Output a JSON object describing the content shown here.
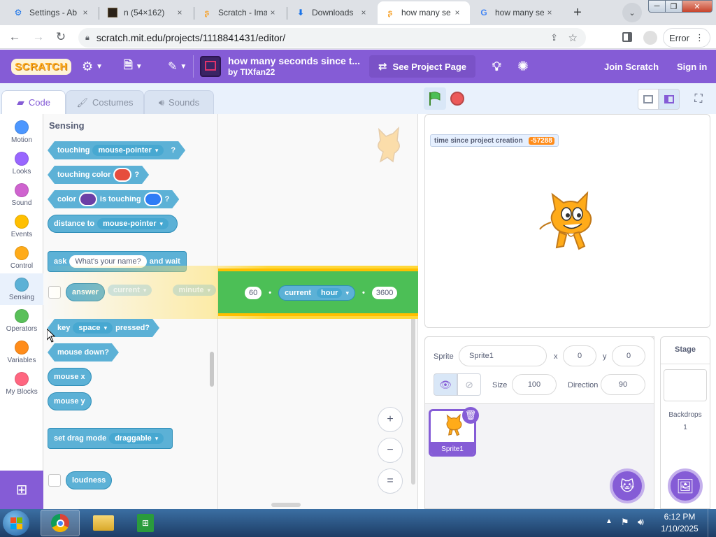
{
  "browser": {
    "tabs": [
      {
        "icon": "gear-icon",
        "title": "Settings - Ab",
        "close": "×"
      },
      {
        "icon": "image-tab-icon",
        "title": "n (54×162)",
        "close": "×"
      },
      {
        "icon": "scratch-tab-icon",
        "title": "Scratch - Ima",
        "close": "×"
      },
      {
        "icon": "download-icon",
        "title": "Downloads",
        "close": "×"
      },
      {
        "icon": "scratch-tab-icon",
        "title": "how many se",
        "close": "×"
      },
      {
        "icon": "google-icon",
        "title": "how many se",
        "close": "×"
      }
    ],
    "new_tab": "+",
    "window_min": "─",
    "window_max": "❐",
    "window_close": "✕",
    "url": "scratch.mit.edu/projects/1118841431/editor/",
    "error_label": "Error",
    "icons": [
      "back-icon",
      "forward-icon",
      "reload-icon",
      "lock-icon",
      "share-icon",
      "star-icon",
      "sidepanel-icon",
      "profile-icon",
      "kebab-menu-icon"
    ]
  },
  "menubar": {
    "logo": "SCRATCH",
    "project_title": "how many seconds since t...",
    "author": "by TIXfan22",
    "see_project_page": "See Project Page",
    "join": "Join Scratch",
    "sign_in": "Sign in",
    "color": "#855cd6"
  },
  "editor_tabs": {
    "code": "Code",
    "costumes": "Costumes",
    "sounds": "Sounds"
  },
  "categories": [
    {
      "label": "Motion",
      "color": "#4c97ff"
    },
    {
      "label": "Looks",
      "color": "#9966ff"
    },
    {
      "label": "Sound",
      "color": "#cf63cf"
    },
    {
      "label": "Events",
      "color": "#ffbf00"
    },
    {
      "label": "Control",
      "color": "#ffab19"
    },
    {
      "label": "Sensing",
      "color": "#5cb1d6"
    },
    {
      "label": "Operators",
      "color": "#59c059"
    },
    {
      "label": "Variables",
      "color": "#ff8c1a"
    },
    {
      "label": "My Blocks",
      "color": "#ff6680"
    }
  ],
  "palette": {
    "heading": "Sensing",
    "touching": {
      "word": "touching",
      "menu": "mouse-pointer",
      "q": "?"
    },
    "touching_color": {
      "word": "touching color",
      "color": "#e64d3d",
      "q": "?"
    },
    "color_touching": {
      "word1": "color",
      "color1": "#6b3fa6",
      "word2": "is touching",
      "color2": "#2e7cf6",
      "q": "?"
    },
    "distance": {
      "word": "distance to",
      "menu": "mouse-pointer"
    },
    "ask": {
      "word1": "ask",
      "input": "What's your name?",
      "word2": "and wait"
    },
    "answer": "answer",
    "key": {
      "word": "key",
      "menu": "space",
      "word2": "pressed?"
    },
    "mouse_down": "mouse down?",
    "mouse_x": "mouse x",
    "mouse_y": "mouse y",
    "drag": {
      "word": "set drag mode",
      "menu": "draggable"
    },
    "loudness": "loudness"
  },
  "script": {
    "faded_menu": "current",
    "faded_unit": "minute",
    "n60": "60",
    "current": "current",
    "hour": "hour",
    "n3600": "3600",
    "zoom_in": "+",
    "zoom_out": "−",
    "zoom_reset": "="
  },
  "stage": {
    "monitor_label": "time since project creation",
    "monitor_value": "-57288"
  },
  "sprite_info": {
    "sprite_label": "Sprite",
    "sprite_name": "Sprite1",
    "x_label": "x",
    "x": "0",
    "y_label": "y",
    "y": "0",
    "show_label": "Show",
    "size_label": "Size",
    "size": "100",
    "direction_label": "Direction",
    "direction": "90",
    "thumb_name": "Sprite1"
  },
  "stage_pane": {
    "title": "Stage",
    "backdrops_label": "Backdrops",
    "backdrops": "1"
  },
  "taskbar": {
    "time": "6:12 PM",
    "date": "1/10/2025"
  }
}
